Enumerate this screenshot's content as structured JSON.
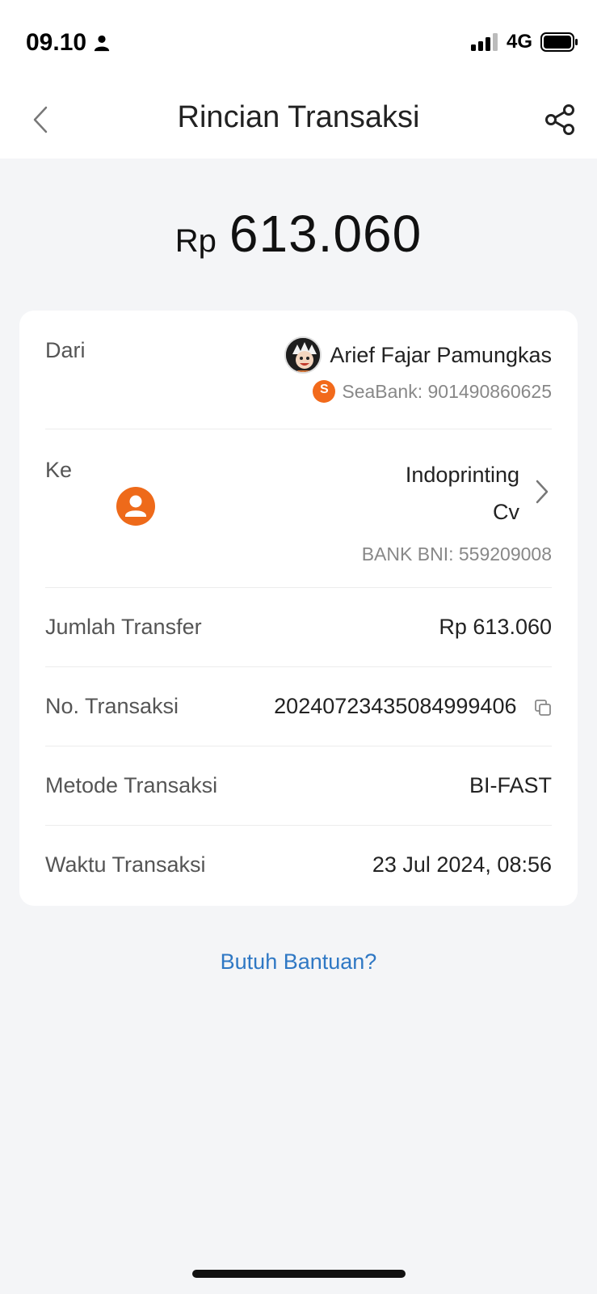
{
  "status_bar": {
    "time": "09.10",
    "network": "4G",
    "icons": [
      "person-icon",
      "signal-icon",
      "battery-icon"
    ]
  },
  "header": {
    "title": "Rincian Transaksi",
    "back_icon": "chevron-left-icon",
    "share_icon": "share-icon"
  },
  "amount": {
    "currency": "Rp",
    "value": "613.060"
  },
  "details": {
    "from": {
      "label": "Dari",
      "name": "Arief Fajar Pamungkas",
      "account": "SeaBank: 901490860625",
      "bank_icon_letter": "S"
    },
    "to": {
      "label": "Ke",
      "name_line1": "Indoprinting",
      "name_line2": "Cv",
      "account": "BANK BNI: 559209008"
    },
    "transfer_amount": {
      "label": "Jumlah Transfer",
      "value": "Rp 613.060"
    },
    "transaction_no": {
      "label": "No. Transaksi",
      "value": "20240723435084999406"
    },
    "method": {
      "label": "Metode Transaksi",
      "value": "BI-FAST"
    },
    "time": {
      "label": "Waktu Transaksi",
      "value": "23 Jul 2024, 08:56"
    }
  },
  "help_link": "Butuh Bantuan?",
  "colors": {
    "accent_orange": "#ee6a1a",
    "link_blue": "#2f78c4",
    "background": "#f4f5f7"
  }
}
